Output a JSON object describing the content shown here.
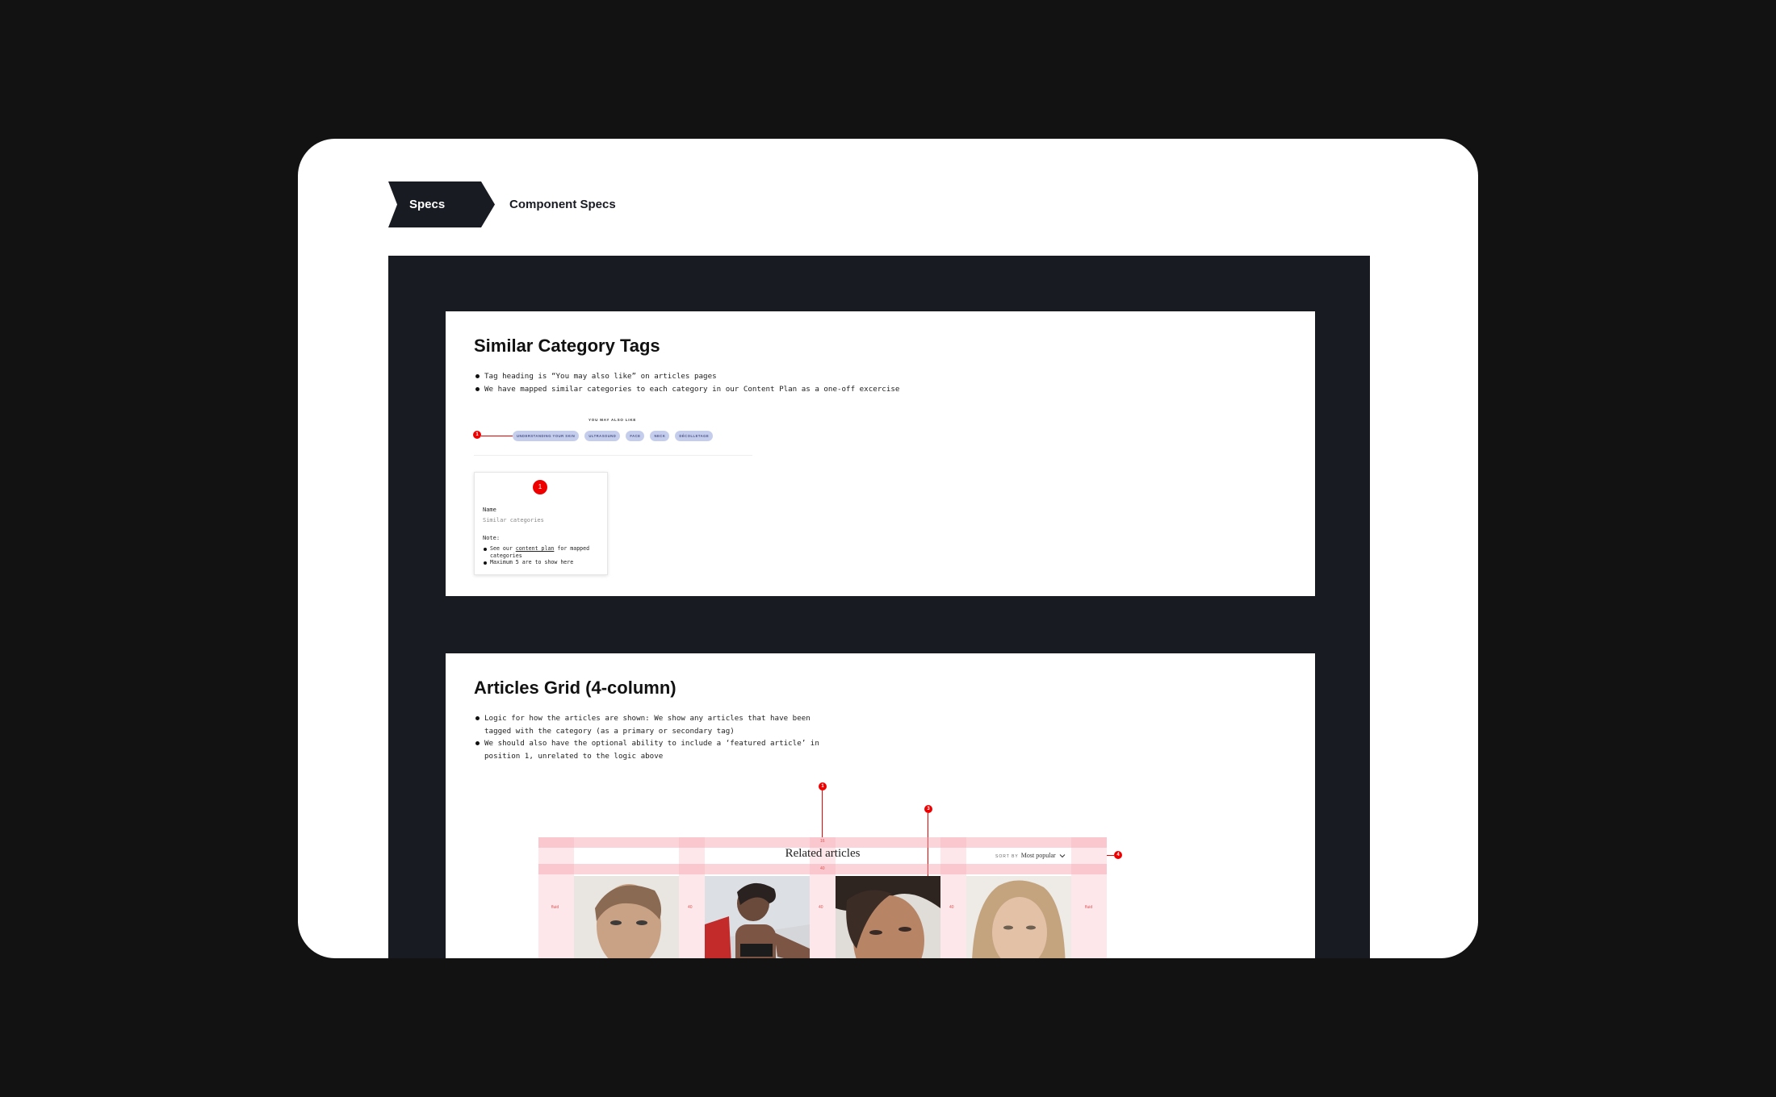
{
  "breadcrumb": {
    "section": "Specs",
    "title": "Component Specs"
  },
  "sections": [
    {
      "title": "Similar Category Tags",
      "bullets": [
        "Tag heading is “You may also like” on articles pages",
        "We have mapped similar categories to each category in our Content Plan as a one-off excercise"
      ],
      "preview": {
        "heading": "YOU MAY ALSO LIKE",
        "tags": [
          "UNDERSTANDING YOUR SKIN",
          "ULTRASOUND",
          "FACE",
          "NECK",
          "DÉCOLLETAGE"
        ],
        "marker": "1"
      },
      "note": {
        "marker": "1",
        "name_label": "Name",
        "name_value": "Similar categories",
        "note_label": "Note:",
        "items": [
          {
            "pre": "See our ",
            "link": "content plan",
            "post": " for mapped categories"
          },
          {
            "pre": "Maximum 5 are to show here",
            "link": "",
            "post": ""
          }
        ]
      }
    },
    {
      "title": "Articles Grid (4-column)",
      "bullets": [
        "Logic for how the articles are shown: We show any articles that have been tagged with the category (as a primary or secondary tag)",
        "We should also have the optional ability to include a ‘featured article’ in position 1, unrelated to the logic above"
      ],
      "preview": {
        "heading": "Related articles",
        "sort_label": "SORT BY",
        "sort_value": "Most popular",
        "markers": [
          "1",
          "3",
          "4"
        ],
        "spacing": {
          "outer": "fluid",
          "gutter": "40",
          "top": "16",
          "mid": "40"
        }
      }
    }
  ],
  "colors": {
    "page_bg": "#121212",
    "card_bg": "#ffffff",
    "panel_bg": "#181b22",
    "marker": "#e00000",
    "tag_bg": "#c5cdec",
    "grid_tint": "#fde7ea"
  },
  "icons": [
    "chevron-down-icon"
  ]
}
